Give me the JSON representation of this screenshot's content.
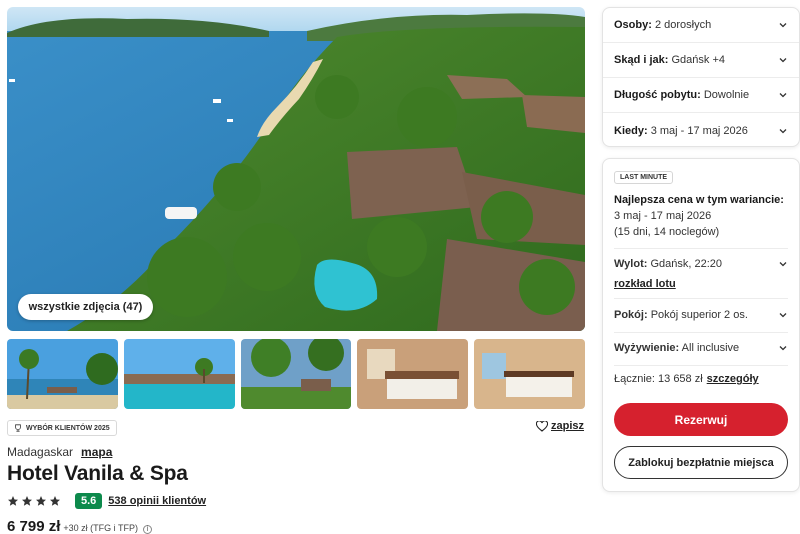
{
  "hero": {
    "all_photos_label": "wszystkie zdjęcia (47)"
  },
  "badge": {
    "label": "WYBÓR KLIENTÓW 2025"
  },
  "save": {
    "label": "zapisz"
  },
  "location": {
    "country": "Madagaskar",
    "map_link": "mapa"
  },
  "hotel": {
    "name": "Hotel Vanila & Spa",
    "stars": 4,
    "score": "5.6",
    "reviews": "538 opinii klientów",
    "price": "6 799 zł",
    "price_extra": "+30 zł (TFG i TFP)"
  },
  "filters": [
    {
      "label": "Osoby:",
      "value": "2 dorosłych"
    },
    {
      "label": "Skąd i jak:",
      "value": "Gdańsk +4"
    },
    {
      "label": "Długość pobytu:",
      "value": "Dowolnie"
    },
    {
      "label": "Kiedy:",
      "value": "3 maj - 17 maj 2026"
    }
  ],
  "offer": {
    "tag": "LAST MINUTE",
    "best_label": "Najlepsza cena w tym wariancie:",
    "dates": "3 maj - 17 maj 2026",
    "duration": "(15 dni, 14 noclegów)",
    "flight_label": "Wylot:",
    "flight_value": "Gdańsk, 22:20",
    "schedule_link": "rozkład lotu",
    "room_label": "Pokój:",
    "room_value": "Pokój superior 2 os.",
    "board_label": "Wyżywienie:",
    "board_value": "All inclusive",
    "total_label": "Łącznie: 13 658 zł",
    "details_link": "szczegóły",
    "book_button": "Rezerwuj",
    "block_button": "Zablokuj bezpłatnie miejsca"
  },
  "colors": {
    "accent": "#d6212e",
    "score": "#0d8a4c"
  }
}
